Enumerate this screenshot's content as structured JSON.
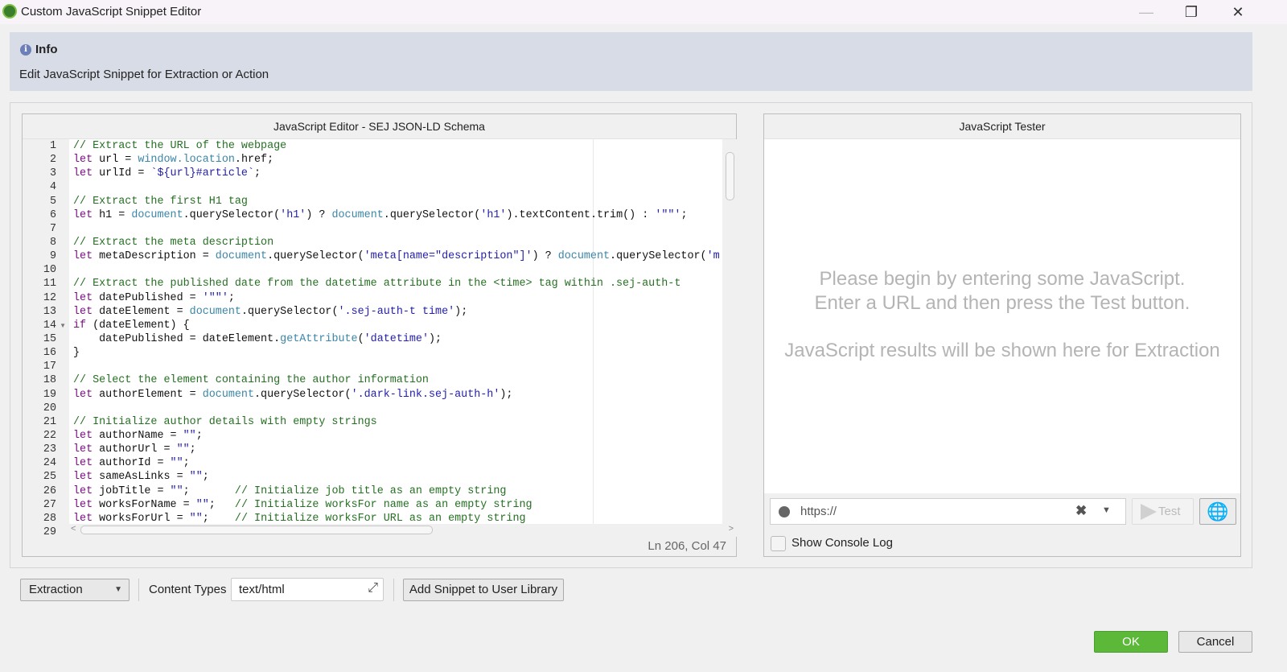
{
  "window": {
    "title": "Custom JavaScript Snippet Editor",
    "minimize": "—",
    "restore": "❐",
    "close": "✕"
  },
  "info": {
    "title": "Info",
    "icon": "i",
    "text": "Edit JavaScript Snippet for Extraction or Action"
  },
  "editor": {
    "title": "JavaScript Editor - SEJ JSON-LD Schema",
    "status": "Ln 206, Col 47",
    "fold_marker_line": 14,
    "lines": [
      [
        [
          "c",
          "// Extract the URL of the webpage"
        ]
      ],
      [
        [
          "k",
          "let"
        ],
        [
          "p",
          " url = "
        ],
        [
          "v",
          "window.location"
        ],
        [
          "p",
          ".href;"
        ]
      ],
      [
        [
          "k",
          "let"
        ],
        [
          "p",
          " urlId = "
        ],
        [
          "s",
          "`${url}#article`"
        ],
        [
          "p",
          ";"
        ]
      ],
      [],
      [
        [
          "c",
          "// Extract the first H1 tag"
        ]
      ],
      [
        [
          "k",
          "let"
        ],
        [
          "p",
          " h1 = "
        ],
        [
          "v",
          "document"
        ],
        [
          "p",
          ".querySelector("
        ],
        [
          "s",
          "'h1'"
        ],
        [
          "p",
          ") ? "
        ],
        [
          "v",
          "document"
        ],
        [
          "p",
          ".querySelector("
        ],
        [
          "s",
          "'h1'"
        ],
        [
          "p",
          ").textContent.trim() : "
        ],
        [
          "s",
          "'\"\"'"
        ],
        [
          "p",
          ";"
        ]
      ],
      [],
      [
        [
          "c",
          "// Extract the meta description"
        ]
      ],
      [
        [
          "k",
          "let"
        ],
        [
          "p",
          " metaDescription = "
        ],
        [
          "v",
          "document"
        ],
        [
          "p",
          ".querySelector("
        ],
        [
          "s",
          "'meta[name=\"description\"]'"
        ],
        [
          "p",
          ") ? "
        ],
        [
          "v",
          "document"
        ],
        [
          "p",
          ".querySelector("
        ],
        [
          "s",
          "'m"
        ]
      ],
      [],
      [
        [
          "c",
          "// Extract the published date from the datetime attribute in the <time> tag within .sej-auth-t"
        ]
      ],
      [
        [
          "k",
          "let"
        ],
        [
          "p",
          " datePublished = "
        ],
        [
          "s",
          "'\"\"'"
        ],
        [
          "p",
          ";"
        ]
      ],
      [
        [
          "k",
          "let"
        ],
        [
          "p",
          " dateElement = "
        ],
        [
          "v",
          "document"
        ],
        [
          "p",
          ".querySelector("
        ],
        [
          "s",
          "'.sej-auth-t time'"
        ],
        [
          "p",
          ");"
        ]
      ],
      [
        [
          "k",
          "if"
        ],
        [
          "p",
          " (dateElement) {"
        ]
      ],
      [
        [
          "p",
          "    datePublished = dateElement."
        ],
        [
          "v",
          "getAttribute"
        ],
        [
          "p",
          "("
        ],
        [
          "s",
          "'datetime'"
        ],
        [
          "p",
          ");"
        ]
      ],
      [
        [
          "p",
          "}"
        ]
      ],
      [],
      [
        [
          "c",
          "// Select the element containing the author information"
        ]
      ],
      [
        [
          "k",
          "let"
        ],
        [
          "p",
          " authorElement = "
        ],
        [
          "v",
          "document"
        ],
        [
          "p",
          ".querySelector("
        ],
        [
          "s",
          "'.dark-link.sej-auth-h'"
        ],
        [
          "p",
          ");"
        ]
      ],
      [],
      [
        [
          "c",
          "// Initialize author details with empty strings"
        ]
      ],
      [
        [
          "k",
          "let"
        ],
        [
          "p",
          " authorName = "
        ],
        [
          "s",
          "\"\""
        ],
        [
          "p",
          ";"
        ]
      ],
      [
        [
          "k",
          "let"
        ],
        [
          "p",
          " authorUrl = "
        ],
        [
          "s",
          "\"\""
        ],
        [
          "p",
          ";"
        ]
      ],
      [
        [
          "k",
          "let"
        ],
        [
          "p",
          " authorId = "
        ],
        [
          "s",
          "\"\""
        ],
        [
          "p",
          ";"
        ]
      ],
      [
        [
          "k",
          "let"
        ],
        [
          "p",
          " sameAsLinks = "
        ],
        [
          "s",
          "\"\""
        ],
        [
          "p",
          ";"
        ]
      ],
      [
        [
          "k",
          "let"
        ],
        [
          "p",
          " jobTitle = "
        ],
        [
          "s",
          "\"\""
        ],
        [
          "p",
          ";       "
        ],
        [
          "c",
          "// Initialize job title as an empty string"
        ]
      ],
      [
        [
          "k",
          "let"
        ],
        [
          "p",
          " worksForName = "
        ],
        [
          "s",
          "\"\""
        ],
        [
          "p",
          ";   "
        ],
        [
          "c",
          "// Initialize worksFor name as an empty string"
        ]
      ],
      [
        [
          "k",
          "let"
        ],
        [
          "p",
          " worksForUrl = "
        ],
        [
          "s",
          "\"\""
        ],
        [
          "p",
          ";    "
        ],
        [
          "c",
          "// Initialize worksFor URL as an empty string"
        ]
      ],
      []
    ]
  },
  "tester": {
    "title": "JavaScript Tester",
    "message_line1": "Please begin by entering some JavaScript.",
    "message_line2": "Enter a URL and then press the Test button.",
    "message_line3": "JavaScript results will be shown here for Extraction",
    "url_value": "https://",
    "clear_icon": "✖",
    "dropdown_icon": "▼",
    "test_label": "Test",
    "web_icon": "🌐",
    "console_label": "Show Console Log",
    "console_checked": false
  },
  "footer": {
    "mode_value": "Extraction",
    "mode_arrow": "▼",
    "content_types_label": "Content Types",
    "content_types_value": "text/html",
    "expand_icon": "⤢",
    "add_snippet_label": "Add Snippet to User Library",
    "ok_label": "OK",
    "cancel_label": "Cancel"
  },
  "colors": {
    "ok_button": "#5cb839",
    "info_background": "#d8dce6",
    "keyword": "#7a0f82",
    "comment": "#257022",
    "string": "#2520a8",
    "builtin": "#3a86a8"
  }
}
